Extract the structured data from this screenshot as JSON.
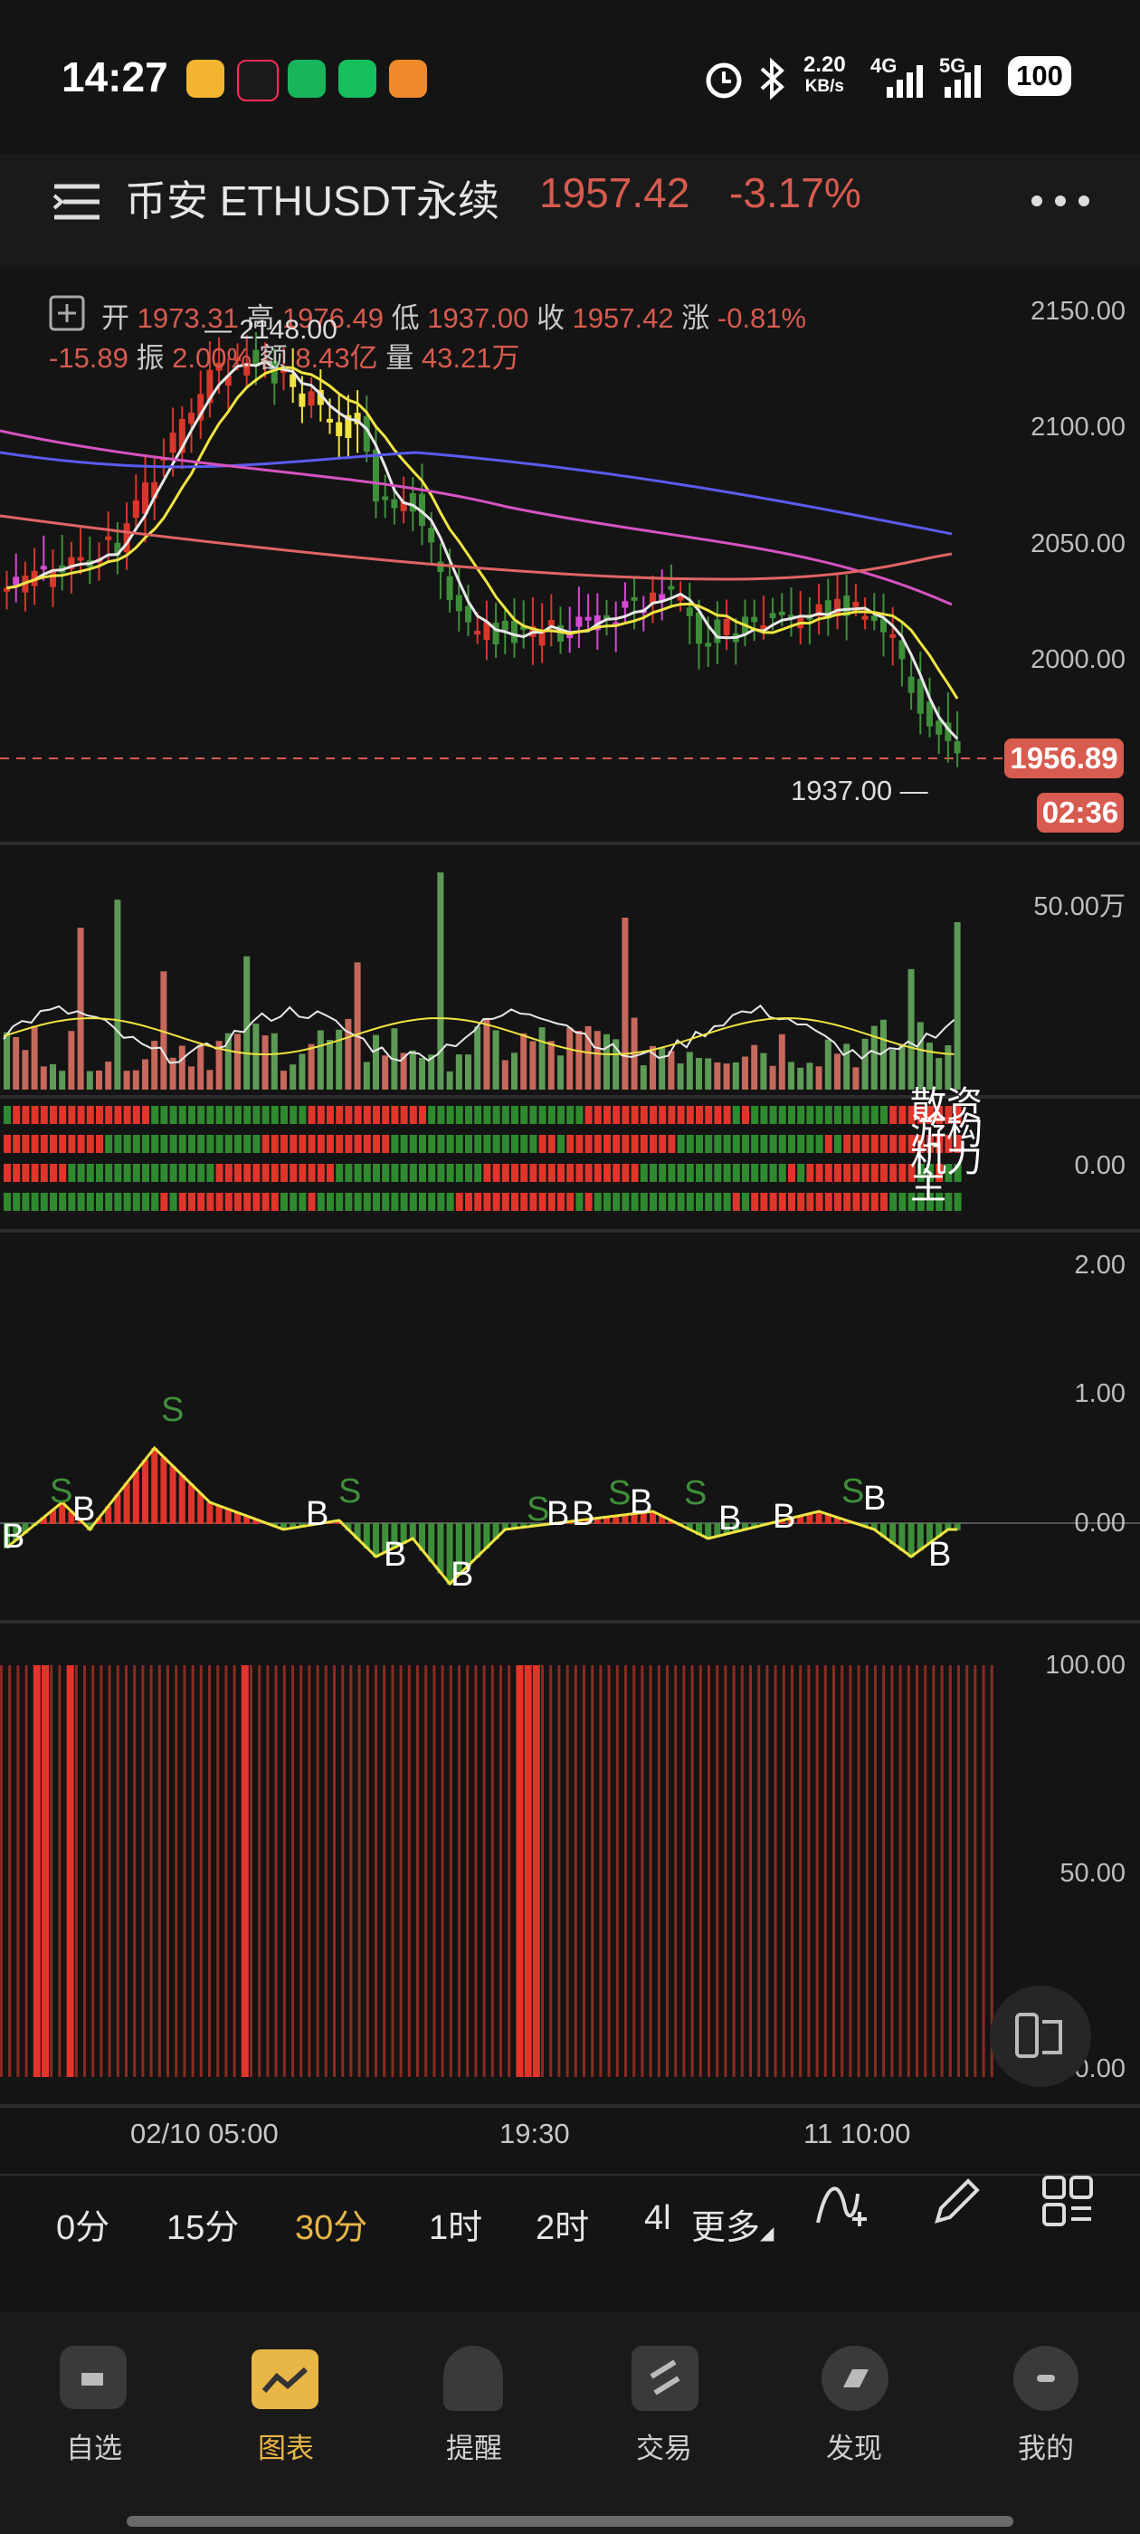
{
  "status_bar": {
    "time": "14:27",
    "net_speed_value": "2.20",
    "net_speed_unit": "KB/s",
    "signal_1": "4G",
    "signal_2": "5G",
    "battery": "100"
  },
  "header": {
    "title": "币安 ETHUSDT永续",
    "last_price": "1957.42",
    "change_pct": "-3.17%"
  },
  "ohlc_bar": {
    "open_label": "开",
    "open": "1973.31",
    "high_label": "高",
    "high": "1976.49",
    "low_label": "低",
    "low": "1937.00",
    "close_label": "收",
    "close": "1957.42",
    "chg_label": "涨",
    "chg_pct": "-0.81%",
    "chg_abs": "-15.89",
    "amp_label": "振",
    "amp": "2.00%",
    "amount_label": "额",
    "amount": "8.43亿",
    "volume_label": "量",
    "volume": "43.21万"
  },
  "main_chart": {
    "y_ticks": [
      "2150.00",
      "2100.00",
      "2050.00",
      "2000.00"
    ],
    "max_marker": "2148.00",
    "min_marker": "1937.00 —",
    "current_price_tag": "1956.89",
    "countdown_tag": "02:36"
  },
  "volume_panel": {
    "y_tick": "50.00万"
  },
  "fund_panel": {
    "y_tick": "0.00",
    "legend_line1": "散资",
    "legend_line2": "游构",
    "legend_line3": "机力",
    "legend_line4": "主"
  },
  "oscillator_panel": {
    "y_ticks": [
      "2.00",
      "1.00",
      "0.00"
    ]
  },
  "bar_panel": {
    "y_ticks": [
      "100.00",
      "50.00",
      "0.00"
    ]
  },
  "x_axis": {
    "labels": [
      "02/10 05:00",
      "19:30",
      "11 10:00"
    ]
  },
  "timeframe_tabs": {
    "items": [
      "0分",
      "15分",
      "30分",
      "1时",
      "2时",
      "4l"
    ],
    "selected": "30分",
    "more": "更多"
  },
  "bottom_nav": {
    "items": [
      "自选",
      "图表",
      "提醒",
      "交易",
      "发现",
      "我的"
    ],
    "selected": "图表"
  },
  "colors": {
    "up": "#d8372b",
    "down": "#3f8f3a",
    "accent": "#e8b547",
    "price_red": "#d75b4f",
    "background": "#141414"
  }
}
